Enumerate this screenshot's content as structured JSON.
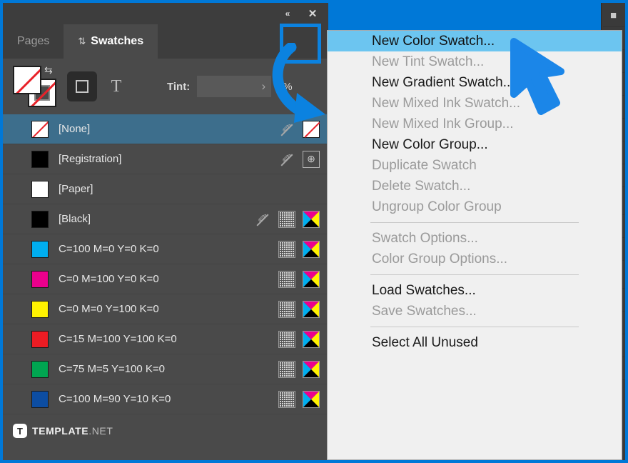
{
  "window": {
    "titlebar": {
      "collapse_icon": "collapse-double-chevron-icon",
      "collapse_glyph": "«",
      "close_icon": "close-icon",
      "close_glyph": "✕"
    }
  },
  "tabs": [
    {
      "label": "Pages",
      "active": false,
      "glyph": ""
    },
    {
      "label": "Swatches",
      "active": true,
      "glyph": "⇅"
    }
  ],
  "toolbar": {
    "fill_stroke_name": "fill-and-stroke-proxy",
    "swap_glyph": "⇆",
    "container_target_label": "□",
    "text_target_label": "T",
    "tint_label": "Tint:",
    "tint_value": "",
    "tint_placeholder": "",
    "tint_chevron": "›",
    "tint_unit": "%"
  },
  "swatches": {
    "rows": [
      {
        "name": "[None]",
        "color": "#ffffff",
        "none": true,
        "selected": true,
        "icons": [
          "pencil-crossed",
          "none-swatch"
        ]
      },
      {
        "name": "[Registration]",
        "color": "#000000",
        "none": false,
        "selected": false,
        "icons": [
          "pencil-crossed",
          "registration"
        ]
      },
      {
        "name": "[Paper]",
        "color": "#ffffff",
        "none": false,
        "selected": false,
        "icons": []
      },
      {
        "name": "[Black]",
        "color": "#000000",
        "none": false,
        "selected": false,
        "icons": [
          "pencil-crossed",
          "dots",
          "cmyk"
        ]
      },
      {
        "name": "C=100 M=0 Y=0 K=0",
        "color": "#00aeef",
        "none": false,
        "selected": false,
        "icons": [
          "dots",
          "cmyk"
        ]
      },
      {
        "name": "C=0 M=100 Y=0 K=0",
        "color": "#ec008c",
        "none": false,
        "selected": false,
        "icons": [
          "dots",
          "cmyk"
        ]
      },
      {
        "name": "C=0 M=0 Y=100 K=0",
        "color": "#fff200",
        "none": false,
        "selected": false,
        "icons": [
          "dots",
          "cmyk"
        ]
      },
      {
        "name": "C=15 M=100 Y=100 K=0",
        "color": "#ed1c24",
        "none": false,
        "selected": false,
        "icons": [
          "dots",
          "cmyk"
        ]
      },
      {
        "name": "C=75 M=5 Y=100 K=0",
        "color": "#00a651",
        "none": false,
        "selected": false,
        "icons": [
          "dots",
          "cmyk"
        ]
      },
      {
        "name": "C=100 M=90 Y=10 K=0",
        "color": "#0c4da2",
        "none": false,
        "selected": false,
        "icons": [
          "dots",
          "cmyk"
        ]
      }
    ]
  },
  "footer": {
    "logo_badge": "T",
    "logo_main": "TEMPLATE",
    "logo_suffix": ".NET"
  },
  "context_menu": {
    "items": [
      {
        "label": "New Color Swatch...",
        "enabled": true,
        "highlighted": true
      },
      {
        "label": "New Tint Swatch...",
        "enabled": false,
        "highlighted": false
      },
      {
        "label": "New Gradient Swatch...",
        "enabled": true,
        "highlighted": false
      },
      {
        "label": "New Mixed Ink Swatch...",
        "enabled": false,
        "highlighted": false
      },
      {
        "label": "New Mixed Ink Group...",
        "enabled": false,
        "highlighted": false
      },
      {
        "label": "New Color Group...",
        "enabled": true,
        "highlighted": false
      },
      {
        "label": "Duplicate Swatch",
        "enabled": false,
        "highlighted": false
      },
      {
        "label": "Delete Swatch...",
        "enabled": false,
        "highlighted": false
      },
      {
        "label": "Ungroup Color Group",
        "enabled": false,
        "highlighted": false
      },
      {
        "separator": true
      },
      {
        "label": "Swatch Options...",
        "enabled": false,
        "highlighted": false
      },
      {
        "label": "Color Group Options...",
        "enabled": false,
        "highlighted": false
      },
      {
        "separator": true
      },
      {
        "label": "Load Swatches...",
        "enabled": true,
        "highlighted": false
      },
      {
        "label": "Save Swatches...",
        "enabled": false,
        "highlighted": false
      },
      {
        "separator": true
      },
      {
        "label": "Select All Unused",
        "enabled": true,
        "highlighted": false
      }
    ]
  },
  "annotation": {
    "highlight_box": "panel-menu-button-highlight",
    "arrow_color": "#0b82e0"
  },
  "colors": {
    "accent_blue": "#0078d7",
    "selection_blue": "#3d6e8c",
    "menu_highlight": "#6cc5f0",
    "panel_bg": "#4a4a4a"
  }
}
